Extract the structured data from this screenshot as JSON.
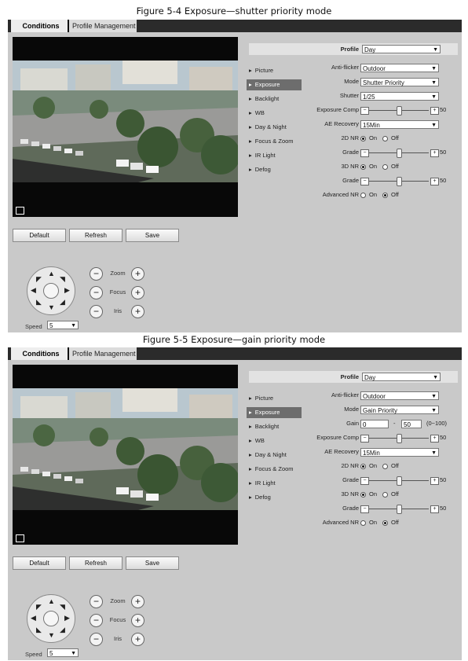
{
  "figures": [
    {
      "caption": "Figure 5-4 Exposure—shutter priority mode",
      "mode": "shutter",
      "tabs": {
        "conditions": "Conditions",
        "profile_management": "Profile Management"
      },
      "buttons": {
        "default": "Default",
        "refresh": "Refresh",
        "save": "Save"
      },
      "ptz": {
        "zoom": "Zoom",
        "focus": "Focus",
        "iris": "Iris",
        "speed_label": "Speed",
        "speed_value": "5"
      },
      "menu": [
        "Picture",
        "Exposure",
        "Backlight",
        "WB",
        "Day & Night",
        "Focus & Zoom",
        "IR Light",
        "Defog"
      ],
      "menu_active": "Exposure",
      "profile": {
        "label": "Profile",
        "value": "Day"
      },
      "fields": {
        "anti_flicker": {
          "label": "Anti-flicker",
          "value": "Outdoor"
        },
        "mode": {
          "label": "Mode",
          "value": "Shutter Priority"
        },
        "shutter": {
          "label": "Shutter",
          "value": "1/25"
        },
        "exposure_comp": {
          "label": "Exposure Comp",
          "value": "50"
        },
        "ae_recovery": {
          "label": "AE Recovery",
          "value": "15Min"
        },
        "nr2d": {
          "label": "2D NR",
          "on": "On",
          "off": "Off",
          "selected": "on"
        },
        "grade2d": {
          "label": "Grade",
          "value": "50"
        },
        "nr3d": {
          "label": "3D NR",
          "on": "On",
          "off": "Off",
          "selected": "on"
        },
        "grade3d": {
          "label": "Grade",
          "value": "50"
        },
        "advanced_nr": {
          "label": "Advanced NR",
          "on": "On",
          "off": "Off",
          "selected": "off"
        }
      }
    },
    {
      "caption": "Figure 5-5 Exposure—gain priority mode",
      "mode": "gain",
      "tabs": {
        "conditions": "Conditions",
        "profile_management": "Profile Management"
      },
      "buttons": {
        "default": "Default",
        "refresh": "Refresh",
        "save": "Save"
      },
      "ptz": {
        "zoom": "Zoom",
        "focus": "Focus",
        "iris": "Iris",
        "speed_label": "Speed",
        "speed_value": "5"
      },
      "menu": [
        "Picture",
        "Exposure",
        "Backlight",
        "WB",
        "Day & Night",
        "Focus & Zoom",
        "IR Light",
        "Defog"
      ],
      "menu_active": "Exposure",
      "profile": {
        "label": "Profile",
        "value": "Day"
      },
      "fields": {
        "anti_flicker": {
          "label": "Anti-flicker",
          "value": "Outdoor"
        },
        "mode": {
          "label": "Mode",
          "value": "Gain Priority"
        },
        "gain": {
          "label": "Gain",
          "min": "0",
          "sep": "-",
          "max": "50",
          "range": "(0~100)"
        },
        "exposure_comp": {
          "label": "Exposure Comp",
          "value": "50"
        },
        "ae_recovery": {
          "label": "AE Recovery",
          "value": "15Min"
        },
        "nr2d": {
          "label": "2D NR",
          "on": "On",
          "off": "Off",
          "selected": "on"
        },
        "grade2d": {
          "label": "Grade",
          "value": "50"
        },
        "nr3d": {
          "label": "3D NR",
          "on": "On",
          "off": "Off",
          "selected": "on"
        },
        "grade3d": {
          "label": "Grade",
          "value": "50"
        },
        "advanced_nr": {
          "label": "Advanced NR",
          "on": "On",
          "off": "Off",
          "selected": "off"
        }
      }
    }
  ]
}
